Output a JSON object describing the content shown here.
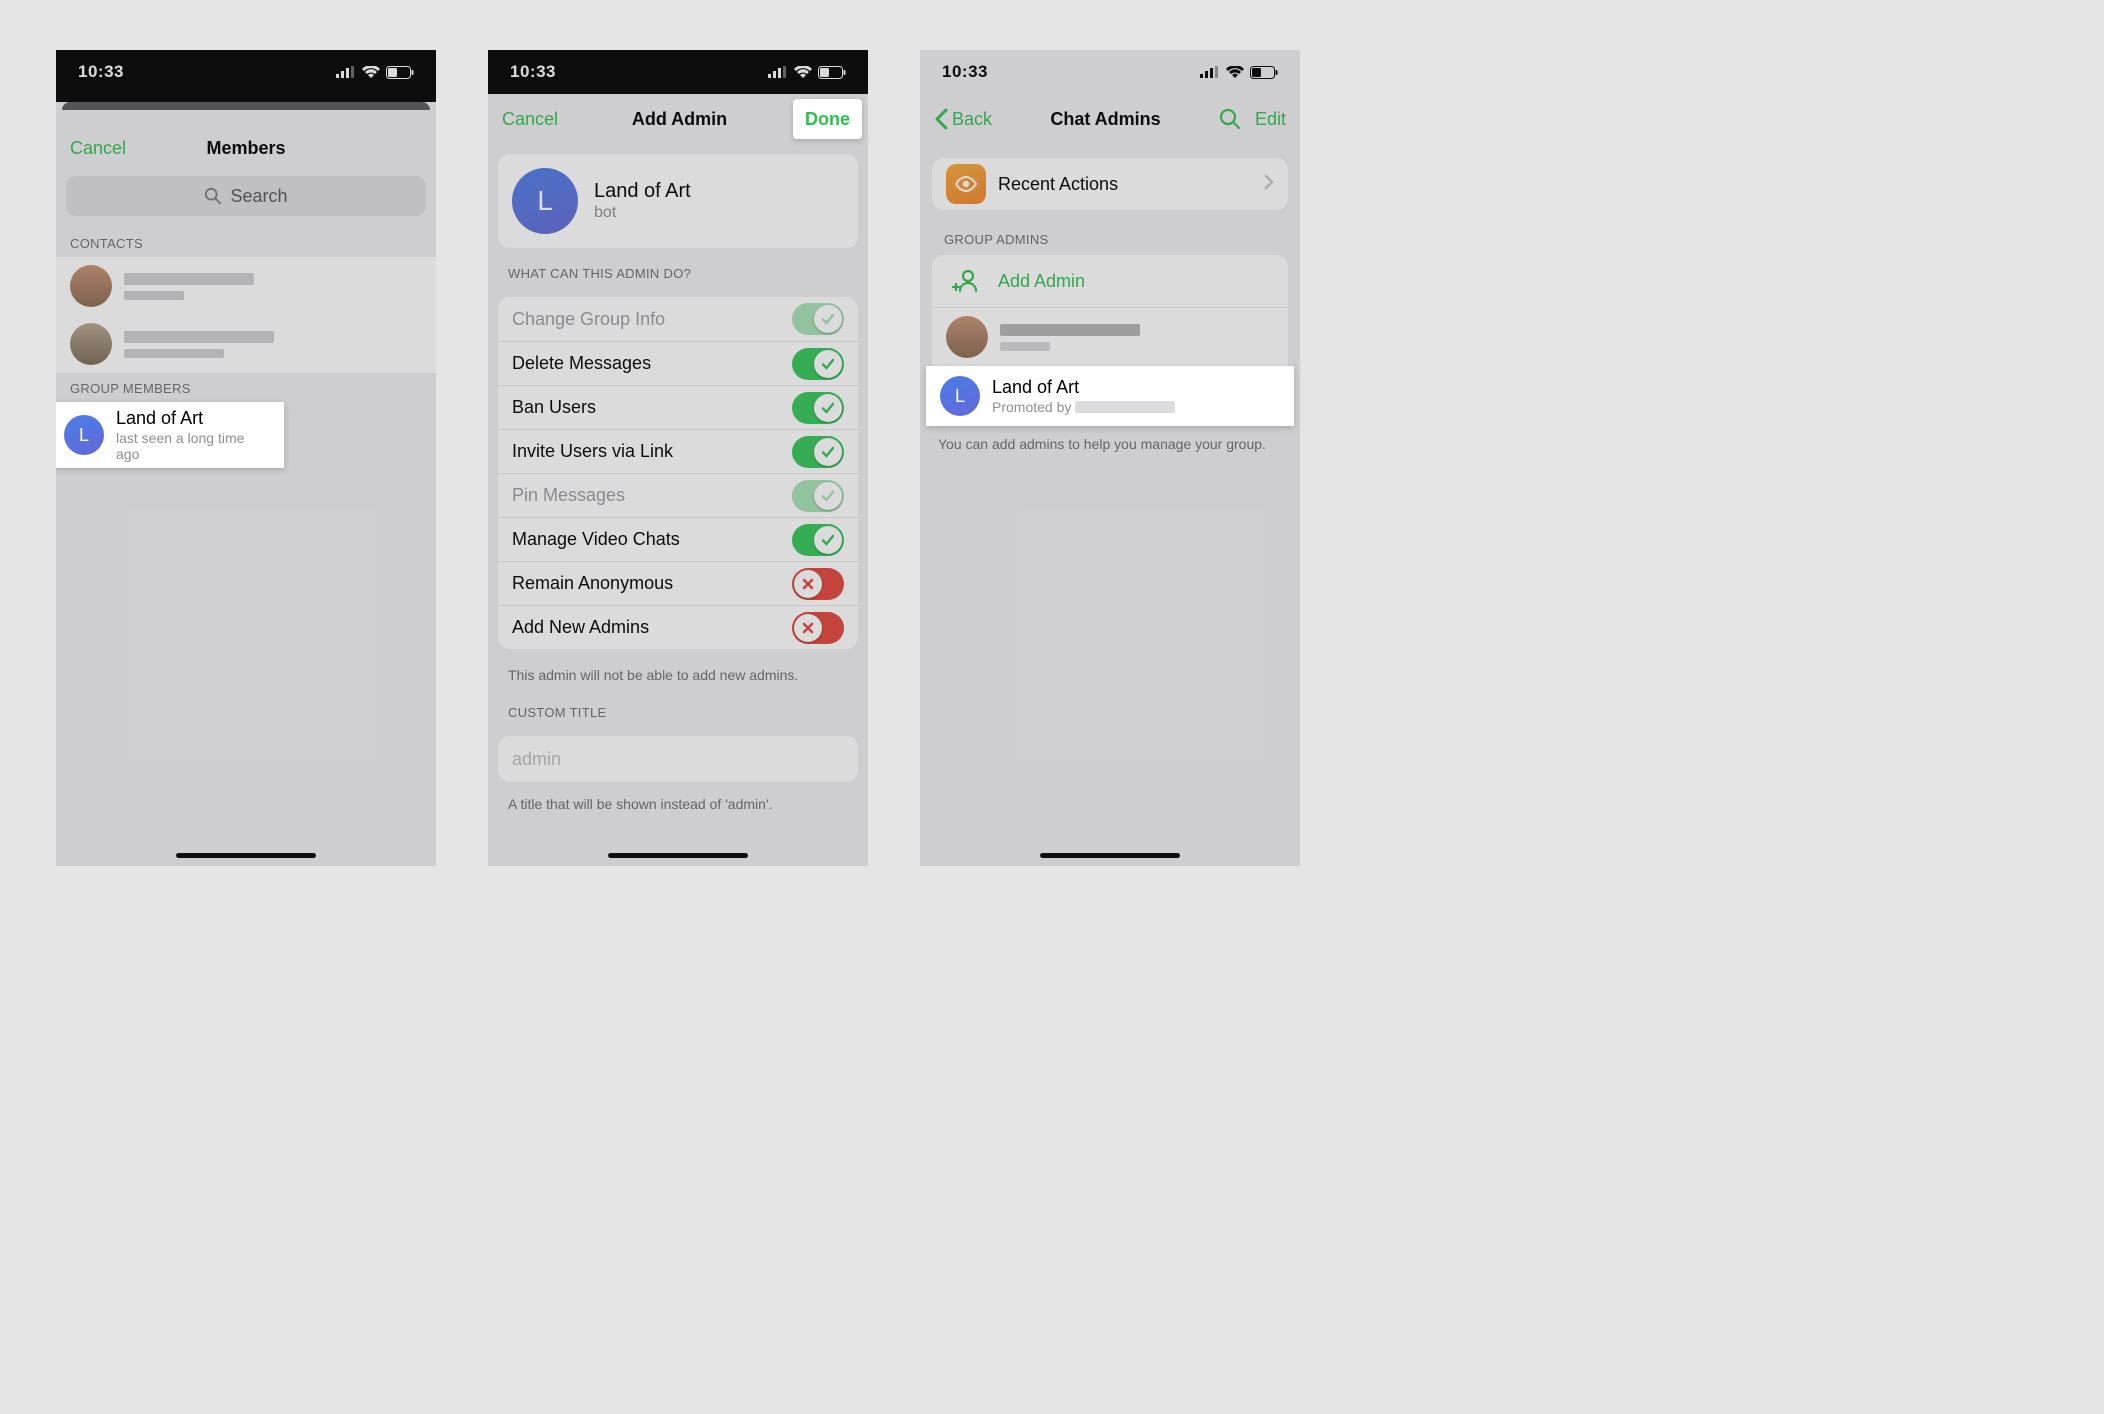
{
  "status": {
    "time": "10:33"
  },
  "phone1": {
    "cancel": "Cancel",
    "title": "Members",
    "search_placeholder": "Search",
    "contacts_header": "CONTACTS",
    "group_members_header": "GROUP MEMBERS",
    "member_name": "Land of Art",
    "member_sub": "last seen a long time ago",
    "avatar_letter": "L"
  },
  "phone2": {
    "cancel": "Cancel",
    "title": "Add Admin",
    "done": "Done",
    "admin_name": "Land of Art",
    "admin_sub": "bot",
    "avatar_letter": "L",
    "section_header": "WHAT CAN THIS ADMIN DO?",
    "permissions": [
      {
        "label": "Change Group Info",
        "state": "on",
        "disabled": true
      },
      {
        "label": "Delete Messages",
        "state": "on",
        "disabled": false
      },
      {
        "label": "Ban Users",
        "state": "on",
        "disabled": false
      },
      {
        "label": "Invite Users via Link",
        "state": "on",
        "disabled": false
      },
      {
        "label": "Pin Messages",
        "state": "on",
        "disabled": true
      },
      {
        "label": "Manage Video Chats",
        "state": "on",
        "disabled": false
      },
      {
        "label": "Remain Anonymous",
        "state": "off",
        "disabled": false
      },
      {
        "label": "Add New Admins",
        "state": "off",
        "disabled": false
      }
    ],
    "footer_note": "This admin will not be able to add new admins.",
    "custom_title_header": "CUSTOM TITLE",
    "custom_title_placeholder": "admin",
    "custom_title_footer": "A title that will be shown instead of 'admin'."
  },
  "phone3": {
    "back": "Back",
    "title": "Chat Admins",
    "edit": "Edit",
    "recent_actions": "Recent Actions",
    "group_admins_header": "GROUP ADMINS",
    "add_admin": "Add Admin",
    "admin_name": "Land of Art",
    "avatar_letter": "L",
    "promoted_by_prefix": "Promoted by ",
    "footer": "You can add admins to help you manage your group."
  }
}
